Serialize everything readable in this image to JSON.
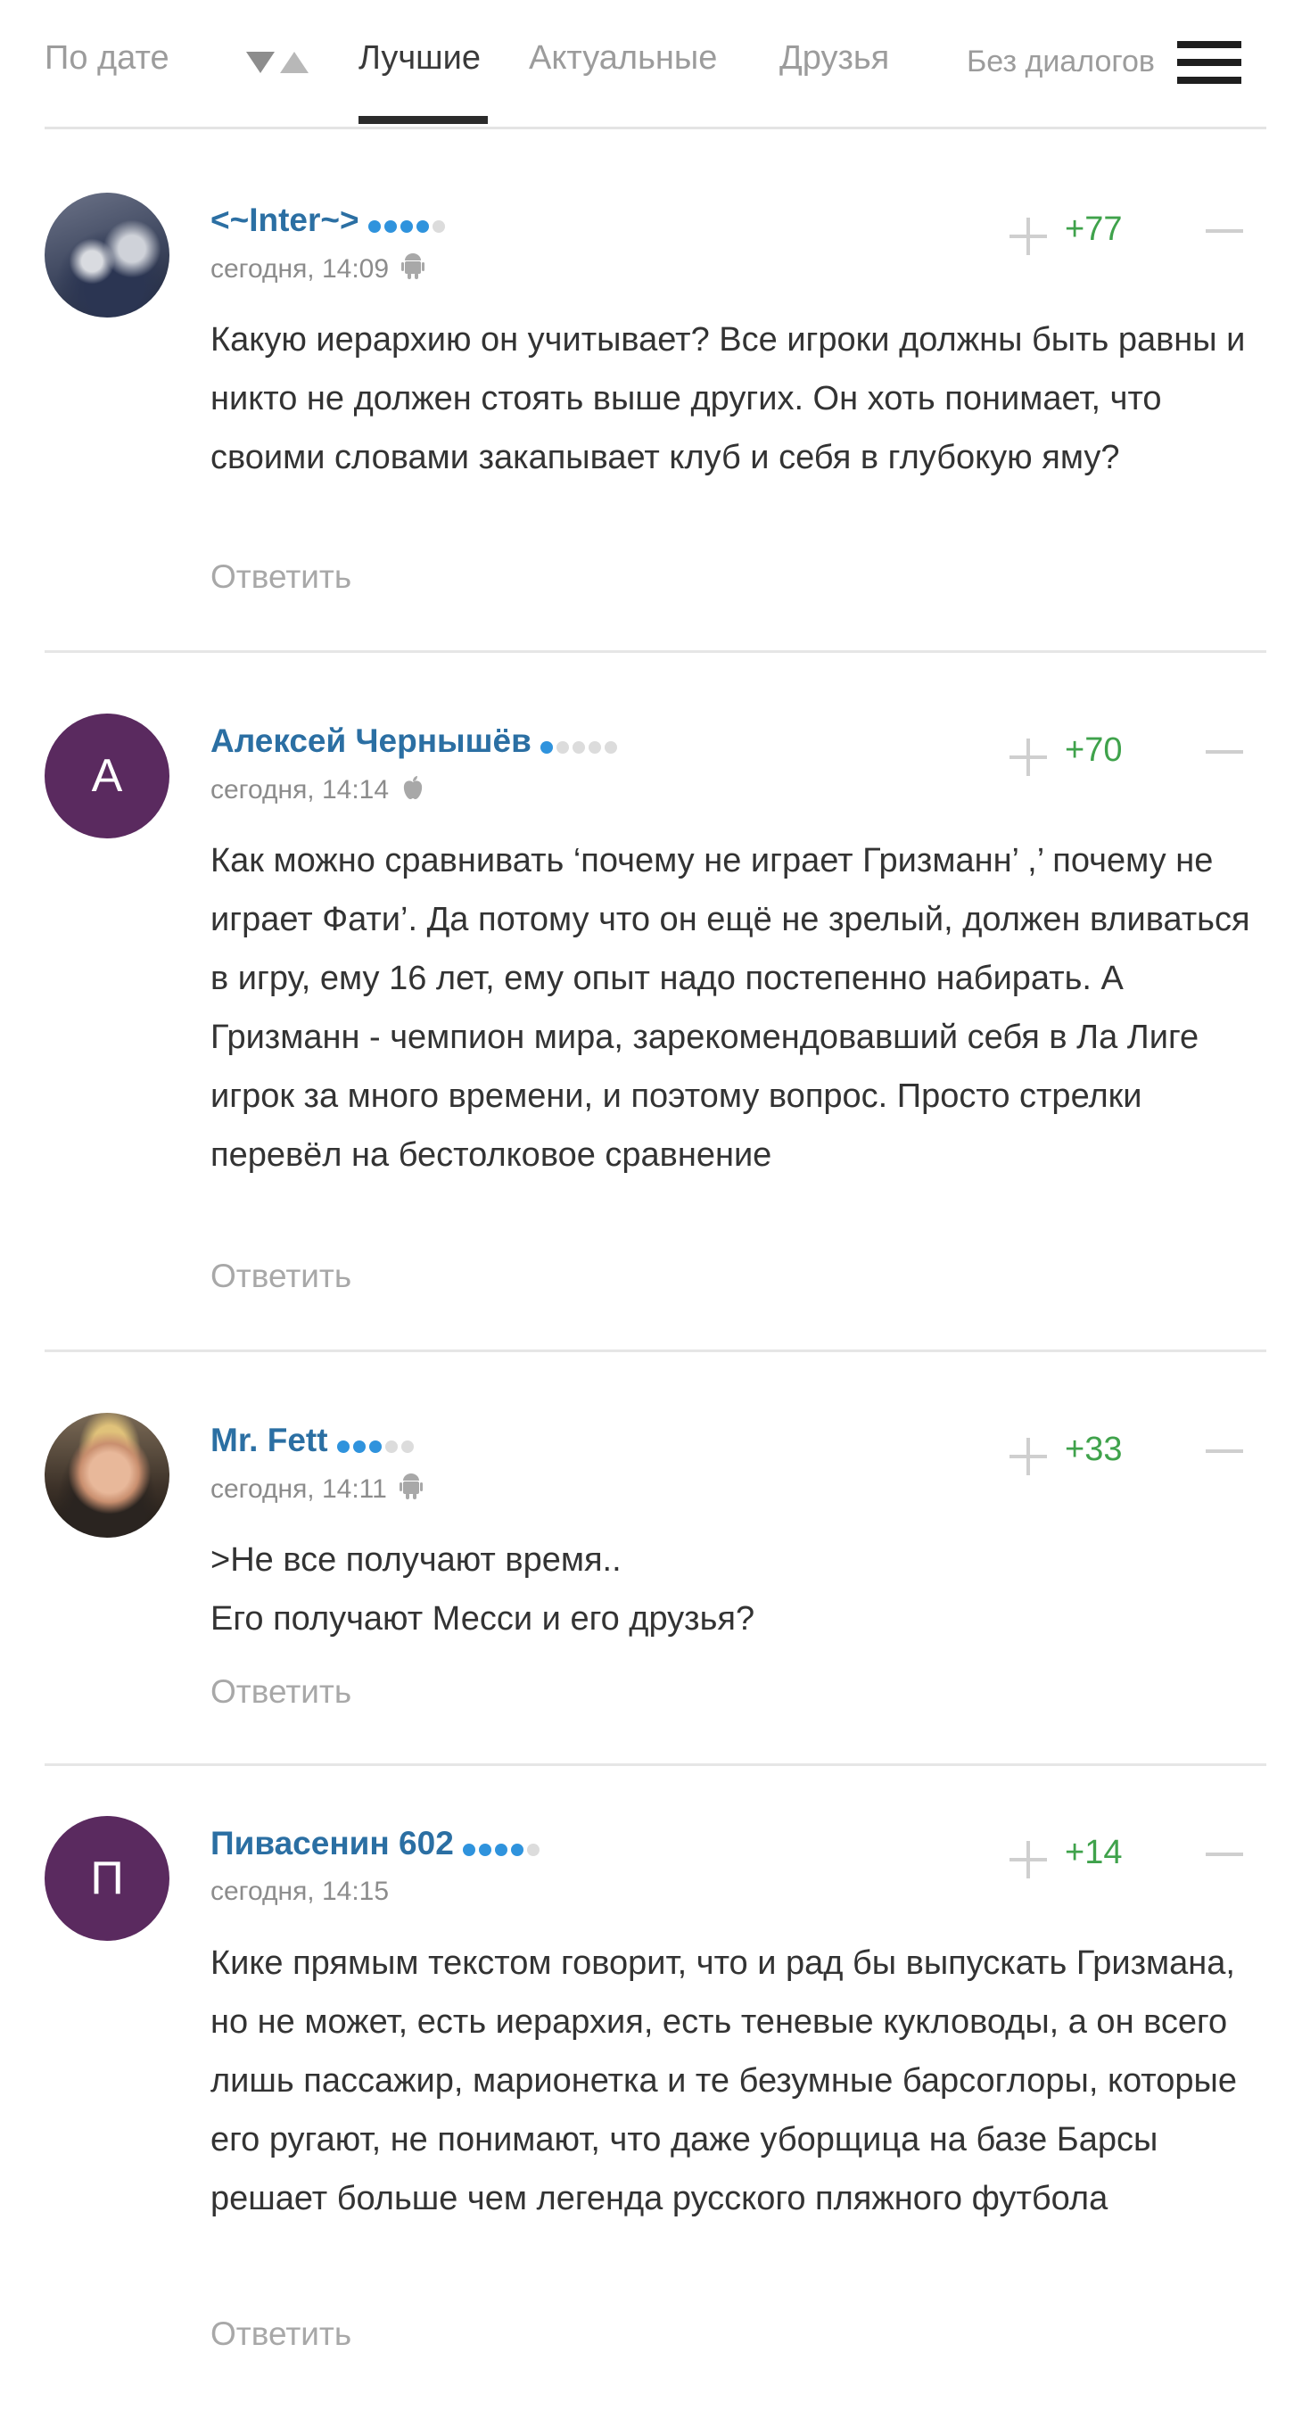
{
  "tabs": {
    "by_date": "По дате",
    "best": "Лучшие",
    "actual": "Актуальные",
    "friends": "Друзья",
    "no_dialogs": "Без диалогов"
  },
  "comments": [
    {
      "author": "<~Inter~>",
      "rank_dots_on": 4,
      "rank_dots_total": 5,
      "time": "сегодня, 14:09",
      "os_icon": "android-icon",
      "score": "+77",
      "text": "Какую иерархию он учитывает? Все игроки должны быть равны и никто не должен стоять выше других. Он хоть понимает, что своими словами закапывает клуб и себя в глубокую яму?",
      "reply": "Ответить"
    },
    {
      "author": "Алексей Чернышёв",
      "avatar_letter": "А",
      "rank_dots_on": 1,
      "rank_dots_total": 5,
      "time": "сегодня, 14:14",
      "os_icon": "apple-icon",
      "score": "+70",
      "text": "Как можно сравнивать ‘почему не играет Гризманн’ ,’ почему не играет Фати’. Да потому что он ещё не зрелый, должен вливаться в игру, ему 16 лет, ему опыт надо постепенно набирать. А Гризманн - чемпион мира, зарекомендовавший себя в Ла Лиге игрок за много времени, и поэтому вопрос. Просто стрелки перевёл на бестолковое сравнение",
      "reply": "Ответить"
    },
    {
      "author": "Mr. Fett",
      "rank_dots_on": 3,
      "rank_dots_total": 5,
      "time": "сегодня, 14:11",
      "os_icon": "android-icon",
      "score": "+33",
      "text": ">Не все получают время..\nЕго получают Месси и его друзья?",
      "reply": "Ответить"
    },
    {
      "author": "Пивасенин 602",
      "avatar_letter": "П",
      "rank_dots_on": 4,
      "rank_dots_total": 5,
      "time": "сегодня, 14:15",
      "score": "+14",
      "text": "Кике прямым текстом говорит, что и рад бы выпускать Гризмана, но не может, есть иерархия, есть теневые кукловоды, а он всего лишь пассажир, марионетка и те безумные барсоглоры, которые его ругают, не понимают, что даже уборщица на базе Барсы решает больше чем легенда русского пляжного футбола",
      "reply": "Ответить"
    }
  ],
  "colors": {
    "author": "#2b6fa3",
    "score": "#3fa24b",
    "rank_on": "#2f93dd",
    "avatar_bg": "#5a2a5f"
  }
}
